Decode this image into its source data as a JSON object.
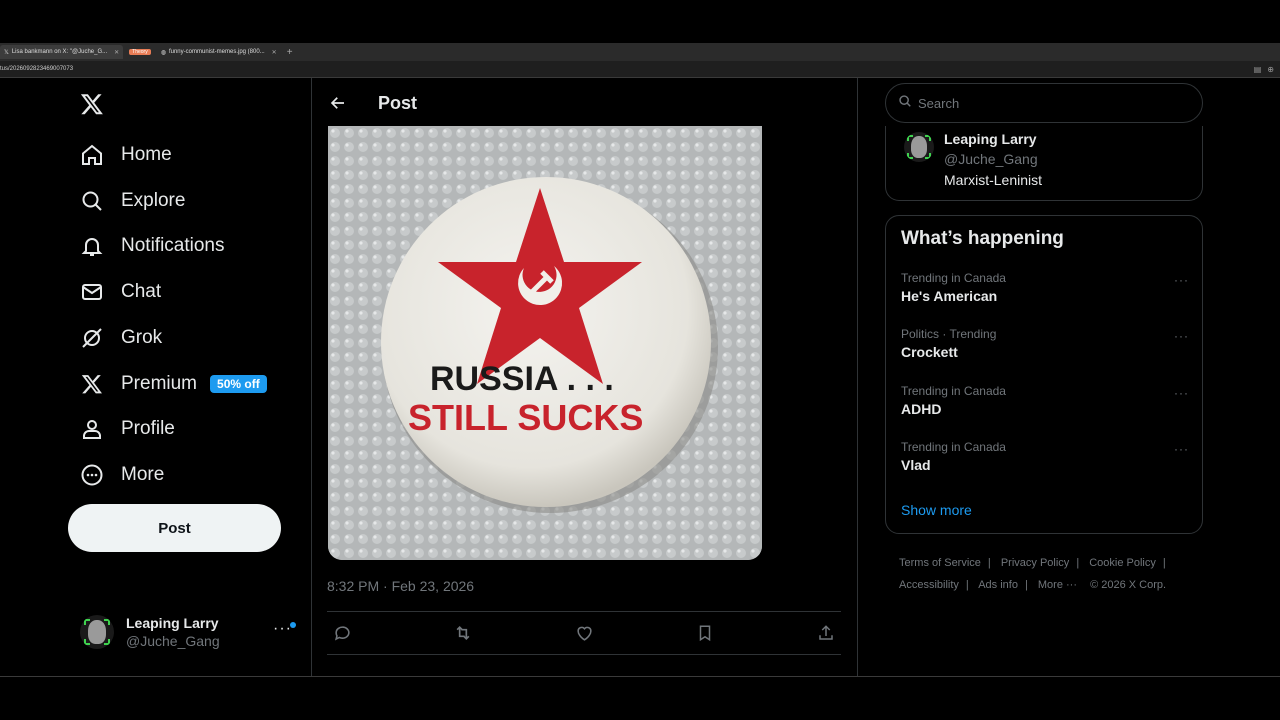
{
  "browser": {
    "tabs": [
      {
        "label": "Lisa bankmann on X: \"@Juche_G...",
        "active": true
      },
      {
        "label": "Theory",
        "pill": true
      },
      {
        "label": "funny-communist-memes.jpg (800...",
        "active": false
      }
    ],
    "url": "tus/2026092823469007073"
  },
  "nav": {
    "items": [
      {
        "label": "Home",
        "icon": "home-icon"
      },
      {
        "label": "Explore",
        "icon": "search-icon"
      },
      {
        "label": "Notifications",
        "icon": "bell-icon"
      },
      {
        "label": "Chat",
        "icon": "mail-icon"
      },
      {
        "label": "Grok",
        "icon": "grok-icon"
      },
      {
        "label": "Premium",
        "icon": "x-logo-icon",
        "badge": "50% off"
      },
      {
        "label": "Profile",
        "icon": "person-icon"
      },
      {
        "label": "More",
        "icon": "more-circle-icon"
      }
    ],
    "post_label": "Post"
  },
  "account": {
    "name": "Leaping Larry",
    "handle": "@Juche_Gang"
  },
  "main": {
    "title": "Post",
    "button_text": {
      "line1": "RUSSIA . . .",
      "line2": "STILL SUCKS"
    },
    "timestamp": "8:32 PM · Feb 23, 2026"
  },
  "search": {
    "placeholder": "Search"
  },
  "who": {
    "name": "Leaping Larry",
    "handle": "@Juche_Gang",
    "bio": "Marxist-Leninist"
  },
  "trends": {
    "title": "What’s happening",
    "items": [
      {
        "context": "Trending in Canada",
        "name": "He's American"
      },
      {
        "context": "Politics · Trending",
        "name": "Crockett"
      },
      {
        "context": "Trending in Canada",
        "name": "ADHD"
      },
      {
        "context": "Trending in Canada",
        "name": "Vlad"
      }
    ],
    "show_more": "Show more"
  },
  "footer": {
    "links": [
      "Terms of Service",
      "Privacy Policy",
      "Cookie Policy",
      "Accessibility",
      "Ads info",
      "More ···"
    ],
    "copyright": "© 2026 X Corp."
  },
  "colors": {
    "accent": "#1d9bf0",
    "background": "#000000",
    "star_red": "#c8232c"
  }
}
